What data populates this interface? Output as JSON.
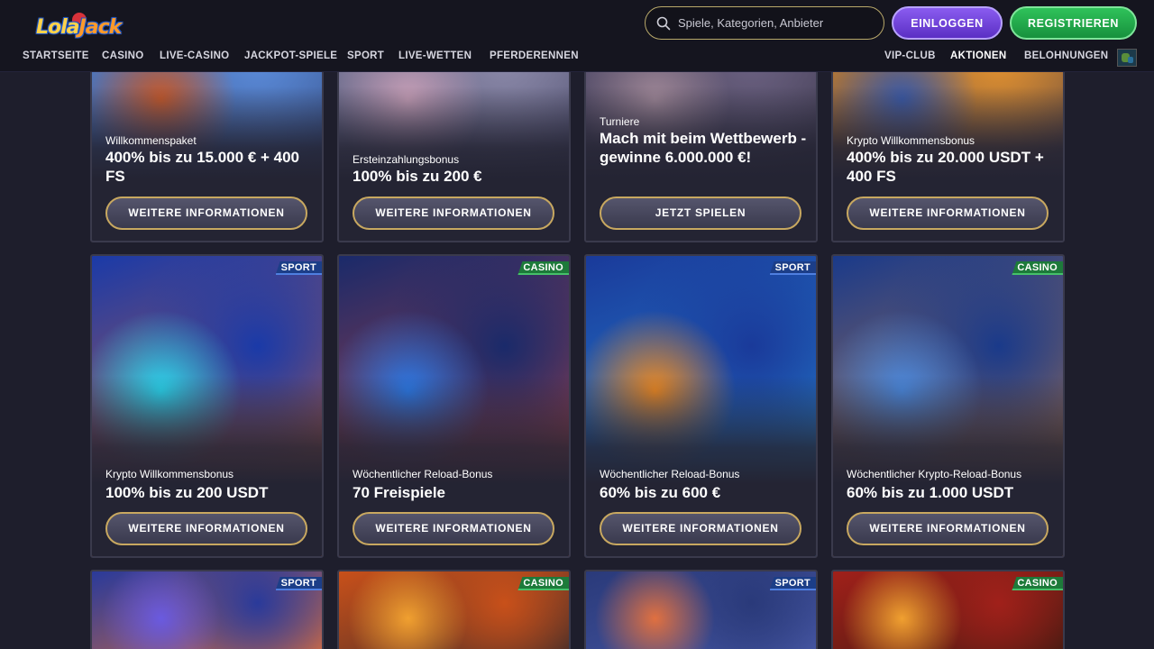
{
  "header": {
    "logo_text_a": "Lola",
    "logo_text_b": "Jack",
    "search_placeholder": "Spiele, Kategorien, Anbieter",
    "login_label": "EINLOGGEN",
    "register_label": "REGISTRIEREN"
  },
  "nav": {
    "left": [
      "STARTSEITE",
      "CASINO",
      "LIVE-CASINO",
      "JACKPOT-SPIELE",
      "SPORT",
      "LIVE-WETTEN",
      "PFERDERENNEN"
    ],
    "right": [
      "VIP-CLUB",
      "AKTIONEN",
      "BELOHNUNGEN"
    ],
    "active": "AKTIONEN"
  },
  "promos": [
    {
      "badge": "",
      "badge_type": "",
      "subtitle": "Willkommenspaket",
      "title": "400% bis zu 15.000 € + 400 FS",
      "button": "WEITERE INFORMATIONEN",
      "palette": [
        "#5a8ad8",
        "#c85a2a",
        "#2a3a6a"
      ]
    },
    {
      "badge": "",
      "badge_type": "",
      "subtitle": "Ersteinzahlungsbonus",
      "title": "100% bis zu 200 €",
      "button": "WEITERE INFORMATIONEN",
      "palette": [
        "#8a88a8",
        "#c8a0b8",
        "#3a3a5a"
      ]
    },
    {
      "badge": "",
      "badge_type": "",
      "subtitle": "Turniere",
      "title": "Mach mit beim Wettbewerb - gewinne 6.000.000 €!",
      "button": "JETZT SPIELEN",
      "palette": [
        "#6a6080",
        "#a08898",
        "#2a2838"
      ]
    },
    {
      "badge": "",
      "badge_type": "",
      "subtitle": "Krypto Willkommensbonus",
      "title": "400% bis zu 20.000 USDT + 400 FS",
      "button": "WEITERE INFORMATIONEN",
      "palette": [
        "#e09030",
        "#3a5aa8",
        "#2a2a4a"
      ]
    },
    {
      "badge": "SPORT",
      "badge_type": "sport",
      "subtitle": "Krypto Willkommensbonus",
      "title": "100% bis zu 200 USDT",
      "button": "WEITERE INFORMATIONEN",
      "palette": [
        "#1a3aa8",
        "#28d8f0",
        "#f06a28"
      ]
    },
    {
      "badge": "CASINO",
      "badge_type": "casino",
      "subtitle": "Wöchentlicher Reload-Bonus",
      "title": "70 Freispiele",
      "button": "WEITERE INFORMATIONEN",
      "palette": [
        "#1a2a6a",
        "#2a7ae8",
        "#e04a3a"
      ]
    },
    {
      "badge": "SPORT",
      "badge_type": "sport",
      "subtitle": "Wöchentlicher Reload-Bonus",
      "title": "60% bis zu 600 €",
      "button": "WEITERE INFORMATIONEN",
      "palette": [
        "#1a3a9a",
        "#f08a20",
        "#2aa0e8"
      ]
    },
    {
      "badge": "CASINO",
      "badge_type": "casino",
      "subtitle": "Wöchentlicher Krypto-Reload-Bonus",
      "title": "60% bis zu 1.000 USDT",
      "button": "WEITERE INFORMATIONEN",
      "palette": [
        "#1a3a8a",
        "#4a8ae0",
        "#e08a3a"
      ]
    },
    {
      "badge": "SPORT",
      "badge_type": "sport",
      "subtitle": "",
      "title": "",
      "button": "",
      "palette": [
        "#2a3a9a",
        "#6a5ae0",
        "#e0703a"
      ]
    },
    {
      "badge": "CASINO",
      "badge_type": "casino",
      "subtitle": "",
      "title": "",
      "button": "",
      "palette": [
        "#c8501a",
        "#f0a030",
        "#3a2a2a"
      ]
    },
    {
      "badge": "SPORT",
      "badge_type": "sport",
      "subtitle": "",
      "title": "",
      "button": "",
      "palette": [
        "#2a3a7a",
        "#e07040",
        "#4a5aa8"
      ]
    },
    {
      "badge": "CASINO",
      "badge_type": "casino",
      "subtitle": "",
      "title": "",
      "button": "",
      "palette": [
        "#a0201a",
        "#f0a030",
        "#3a1a10"
      ]
    }
  ],
  "colors": {
    "background": "#1e1e2c",
    "header": "#15151f",
    "login": "#6c3ee0",
    "register": "#22a84a",
    "sport_badge": "#1c3e88",
    "casino_badge": "#1d7a3a",
    "button_border": "#c8a860"
  },
  "icons": {
    "search": "search-icon",
    "flag": "world-flag-icon"
  }
}
